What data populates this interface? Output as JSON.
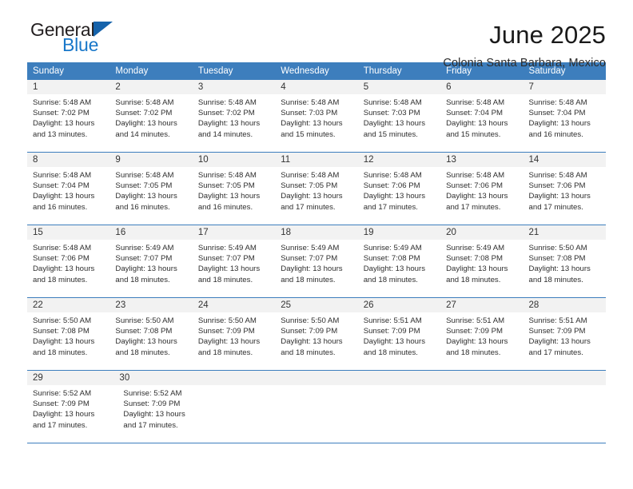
{
  "brand": {
    "name_top": "General",
    "name_bottom": "Blue",
    "flag_color": "#1663ab",
    "blue_text_color": "#1877c9"
  },
  "header": {
    "month_title": "June 2025",
    "location": "Colonia Santa Barbara, Mexico"
  },
  "theme": {
    "header_bar_color": "#3d7ebd",
    "daynum_bg_color": "#f2f2f2",
    "rule_color": "#3d7ebd"
  },
  "weekdays": [
    "Sunday",
    "Monday",
    "Tuesday",
    "Wednesday",
    "Thursday",
    "Friday",
    "Saturday"
  ],
  "weeks": [
    {
      "days": [
        {
          "num": "1",
          "sunrise": "Sunrise: 5:48 AM",
          "sunset": "Sunset: 7:02 PM",
          "daylight_1": "Daylight: 13 hours",
          "daylight_2": "and 13 minutes."
        },
        {
          "num": "2",
          "sunrise": "Sunrise: 5:48 AM",
          "sunset": "Sunset: 7:02 PM",
          "daylight_1": "Daylight: 13 hours",
          "daylight_2": "and 14 minutes."
        },
        {
          "num": "3",
          "sunrise": "Sunrise: 5:48 AM",
          "sunset": "Sunset: 7:02 PM",
          "daylight_1": "Daylight: 13 hours",
          "daylight_2": "and 14 minutes."
        },
        {
          "num": "4",
          "sunrise": "Sunrise: 5:48 AM",
          "sunset": "Sunset: 7:03 PM",
          "daylight_1": "Daylight: 13 hours",
          "daylight_2": "and 15 minutes."
        },
        {
          "num": "5",
          "sunrise": "Sunrise: 5:48 AM",
          "sunset": "Sunset: 7:03 PM",
          "daylight_1": "Daylight: 13 hours",
          "daylight_2": "and 15 minutes."
        },
        {
          "num": "6",
          "sunrise": "Sunrise: 5:48 AM",
          "sunset": "Sunset: 7:04 PM",
          "daylight_1": "Daylight: 13 hours",
          "daylight_2": "and 15 minutes."
        },
        {
          "num": "7",
          "sunrise": "Sunrise: 5:48 AM",
          "sunset": "Sunset: 7:04 PM",
          "daylight_1": "Daylight: 13 hours",
          "daylight_2": "and 16 minutes."
        }
      ]
    },
    {
      "days": [
        {
          "num": "8",
          "sunrise": "Sunrise: 5:48 AM",
          "sunset": "Sunset: 7:04 PM",
          "daylight_1": "Daylight: 13 hours",
          "daylight_2": "and 16 minutes."
        },
        {
          "num": "9",
          "sunrise": "Sunrise: 5:48 AM",
          "sunset": "Sunset: 7:05 PM",
          "daylight_1": "Daylight: 13 hours",
          "daylight_2": "and 16 minutes."
        },
        {
          "num": "10",
          "sunrise": "Sunrise: 5:48 AM",
          "sunset": "Sunset: 7:05 PM",
          "daylight_1": "Daylight: 13 hours",
          "daylight_2": "and 16 minutes."
        },
        {
          "num": "11",
          "sunrise": "Sunrise: 5:48 AM",
          "sunset": "Sunset: 7:05 PM",
          "daylight_1": "Daylight: 13 hours",
          "daylight_2": "and 17 minutes."
        },
        {
          "num": "12",
          "sunrise": "Sunrise: 5:48 AM",
          "sunset": "Sunset: 7:06 PM",
          "daylight_1": "Daylight: 13 hours",
          "daylight_2": "and 17 minutes."
        },
        {
          "num": "13",
          "sunrise": "Sunrise: 5:48 AM",
          "sunset": "Sunset: 7:06 PM",
          "daylight_1": "Daylight: 13 hours",
          "daylight_2": "and 17 minutes."
        },
        {
          "num": "14",
          "sunrise": "Sunrise: 5:48 AM",
          "sunset": "Sunset: 7:06 PM",
          "daylight_1": "Daylight: 13 hours",
          "daylight_2": "and 17 minutes."
        }
      ]
    },
    {
      "days": [
        {
          "num": "15",
          "sunrise": "Sunrise: 5:48 AM",
          "sunset": "Sunset: 7:06 PM",
          "daylight_1": "Daylight: 13 hours",
          "daylight_2": "and 18 minutes."
        },
        {
          "num": "16",
          "sunrise": "Sunrise: 5:49 AM",
          "sunset": "Sunset: 7:07 PM",
          "daylight_1": "Daylight: 13 hours",
          "daylight_2": "and 18 minutes."
        },
        {
          "num": "17",
          "sunrise": "Sunrise: 5:49 AM",
          "sunset": "Sunset: 7:07 PM",
          "daylight_1": "Daylight: 13 hours",
          "daylight_2": "and 18 minutes."
        },
        {
          "num": "18",
          "sunrise": "Sunrise: 5:49 AM",
          "sunset": "Sunset: 7:07 PM",
          "daylight_1": "Daylight: 13 hours",
          "daylight_2": "and 18 minutes."
        },
        {
          "num": "19",
          "sunrise": "Sunrise: 5:49 AM",
          "sunset": "Sunset: 7:08 PM",
          "daylight_1": "Daylight: 13 hours",
          "daylight_2": "and 18 minutes."
        },
        {
          "num": "20",
          "sunrise": "Sunrise: 5:49 AM",
          "sunset": "Sunset: 7:08 PM",
          "daylight_1": "Daylight: 13 hours",
          "daylight_2": "and 18 minutes."
        },
        {
          "num": "21",
          "sunrise": "Sunrise: 5:50 AM",
          "sunset": "Sunset: 7:08 PM",
          "daylight_1": "Daylight: 13 hours",
          "daylight_2": "and 18 minutes."
        }
      ]
    },
    {
      "days": [
        {
          "num": "22",
          "sunrise": "Sunrise: 5:50 AM",
          "sunset": "Sunset: 7:08 PM",
          "daylight_1": "Daylight: 13 hours",
          "daylight_2": "and 18 minutes."
        },
        {
          "num": "23",
          "sunrise": "Sunrise: 5:50 AM",
          "sunset": "Sunset: 7:08 PM",
          "daylight_1": "Daylight: 13 hours",
          "daylight_2": "and 18 minutes."
        },
        {
          "num": "24",
          "sunrise": "Sunrise: 5:50 AM",
          "sunset": "Sunset: 7:09 PM",
          "daylight_1": "Daylight: 13 hours",
          "daylight_2": "and 18 minutes."
        },
        {
          "num": "25",
          "sunrise": "Sunrise: 5:50 AM",
          "sunset": "Sunset: 7:09 PM",
          "daylight_1": "Daylight: 13 hours",
          "daylight_2": "and 18 minutes."
        },
        {
          "num": "26",
          "sunrise": "Sunrise: 5:51 AM",
          "sunset": "Sunset: 7:09 PM",
          "daylight_1": "Daylight: 13 hours",
          "daylight_2": "and 18 minutes."
        },
        {
          "num": "27",
          "sunrise": "Sunrise: 5:51 AM",
          "sunset": "Sunset: 7:09 PM",
          "daylight_1": "Daylight: 13 hours",
          "daylight_2": "and 18 minutes."
        },
        {
          "num": "28",
          "sunrise": "Sunrise: 5:51 AM",
          "sunset": "Sunset: 7:09 PM",
          "daylight_1": "Daylight: 13 hours",
          "daylight_2": "and 17 minutes."
        }
      ]
    },
    {
      "days": [
        {
          "num": "29",
          "sunrise": "Sunrise: 5:52 AM",
          "sunset": "Sunset: 7:09 PM",
          "daylight_1": "Daylight: 13 hours",
          "daylight_2": "and 17 minutes."
        },
        {
          "num": "30",
          "sunrise": "Sunrise: 5:52 AM",
          "sunset": "Sunset: 7:09 PM",
          "daylight_1": "Daylight: 13 hours",
          "daylight_2": "and 17 minutes."
        }
      ]
    }
  ]
}
